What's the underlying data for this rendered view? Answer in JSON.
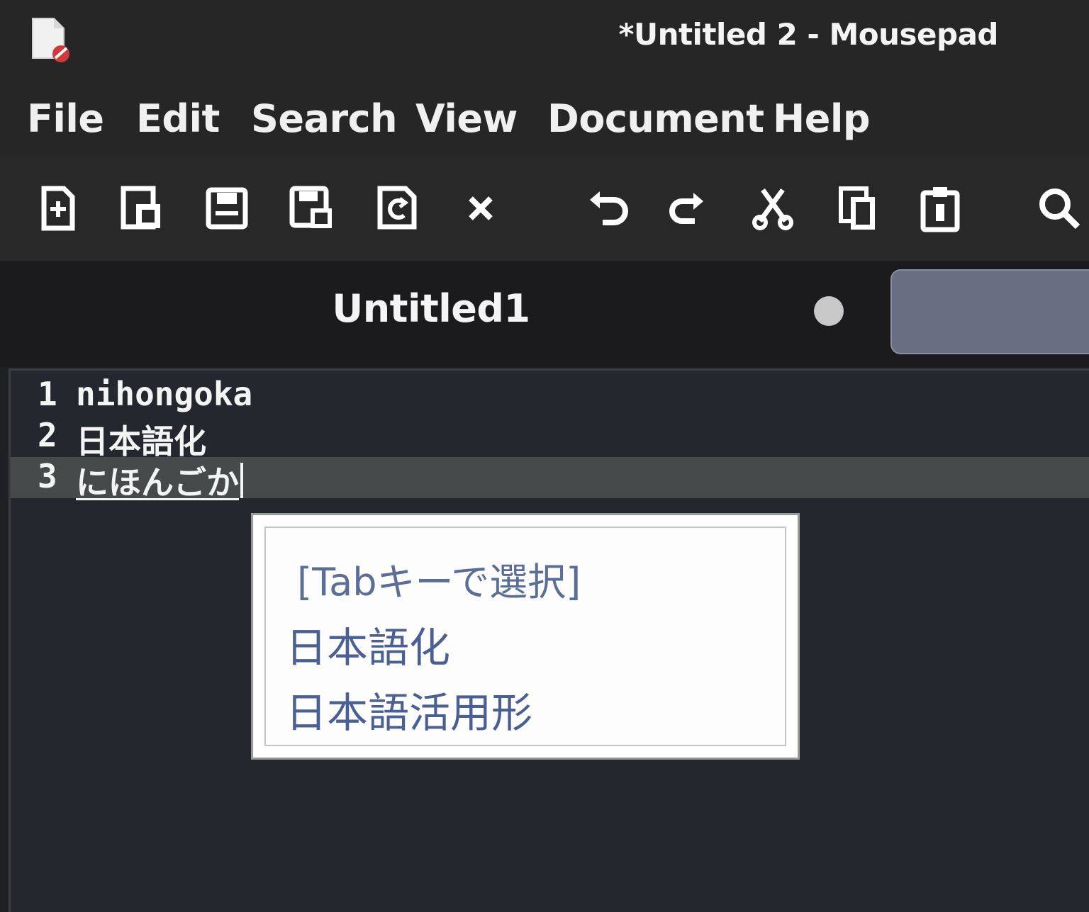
{
  "window": {
    "title": "*Untitled 2 - Mousepad",
    "app_icon": "mousepad-icon"
  },
  "menubar": {
    "items": [
      {
        "label": "File"
      },
      {
        "label": "Edit"
      },
      {
        "label": "Search"
      },
      {
        "label": "View"
      },
      {
        "label": "Document"
      },
      {
        "label": "Help"
      }
    ]
  },
  "toolbar": {
    "buttons": [
      {
        "icon": "new-document-icon"
      },
      {
        "icon": "new-window-icon"
      },
      {
        "icon": "save-icon"
      },
      {
        "icon": "save-as-icon"
      },
      {
        "icon": "revert-icon"
      },
      {
        "icon": "close-icon"
      },
      {
        "icon": "undo-icon"
      },
      {
        "icon": "redo-icon"
      },
      {
        "icon": "cut-icon"
      },
      {
        "icon": "copy-icon"
      },
      {
        "icon": "paste-icon"
      },
      {
        "icon": "search-icon"
      }
    ]
  },
  "tabs": [
    {
      "label": "Untitled1",
      "active": true,
      "modified_indicator": "dot-icon"
    },
    {
      "label": "",
      "active": false
    }
  ],
  "editor": {
    "lines": [
      {
        "number": "1",
        "text": "nihongoka"
      },
      {
        "number": "2",
        "text": "日本語化"
      },
      {
        "number": "3",
        "text": "にほんごか",
        "preedit": true,
        "current": true
      }
    ]
  },
  "candidate_popup": {
    "hint": "[Tabキーで選択]",
    "candidates": [
      "日本語化",
      "日本語活用形"
    ]
  },
  "colors": {
    "background": "#1e2024",
    "editor_bg": "#24282e",
    "current_line": "#464a4a",
    "candidate_text": "#4a5f94"
  }
}
